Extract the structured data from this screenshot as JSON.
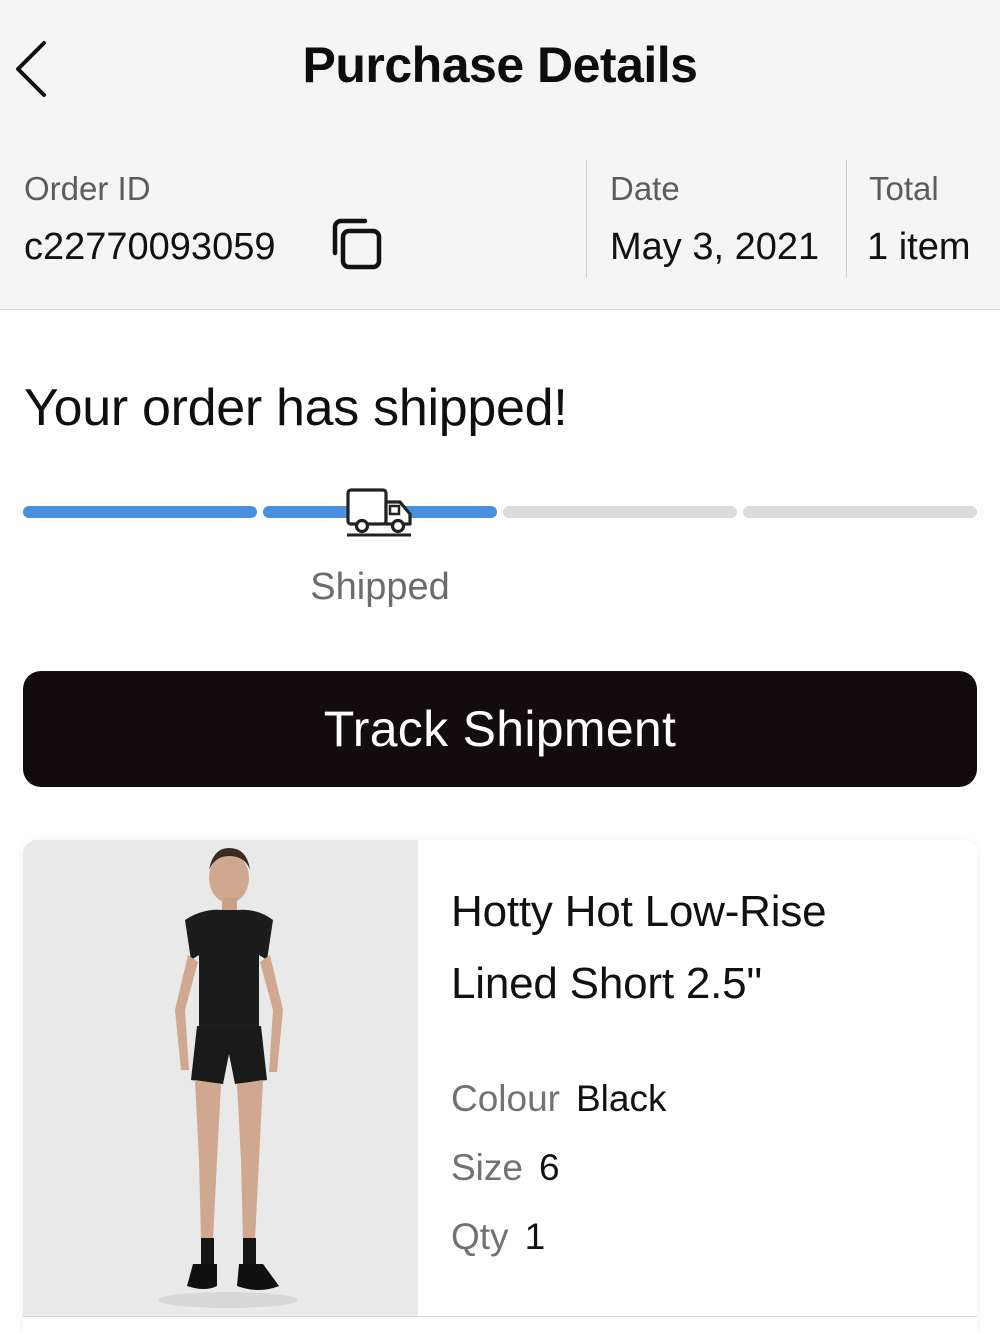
{
  "header": {
    "title": "Purchase Details",
    "back_icon": "chevron-left-icon"
  },
  "order": {
    "id_label": "Order ID",
    "id_value": "c22770093059",
    "copy_icon": "copy-icon",
    "date_label": "Date",
    "date_value": "May 3, 2021",
    "total_label": "Total",
    "total_value": "1 item"
  },
  "status": {
    "heading": "Your order has shipped!",
    "current_step_label": "Shipped",
    "progress_segments": 4,
    "progress_filled_fraction": 0.5,
    "progress_icon": "truck-icon",
    "active_color": "#4a90e2",
    "inactive_color": "#dcdcdc"
  },
  "actions": {
    "track_label": "Track Shipment"
  },
  "item": {
    "name_line1": "Hotty Hot Low-Rise",
    "name_line2": "Lined Short 2.5\"",
    "colour_label": "Colour",
    "colour_value": "Black",
    "size_label": "Size",
    "size_value": "6",
    "qty_label": "Qty",
    "qty_value": "1"
  }
}
